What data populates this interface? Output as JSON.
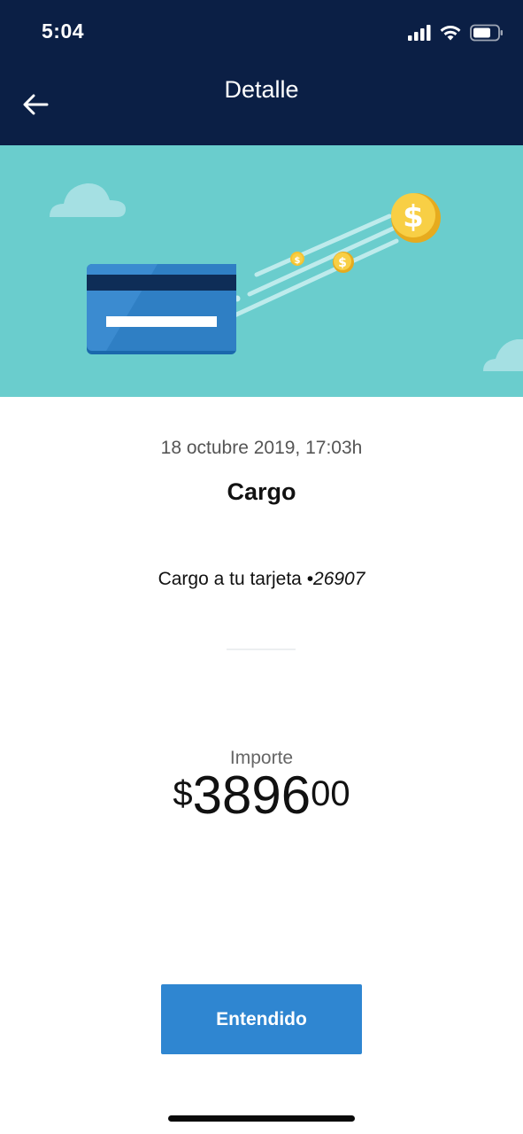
{
  "status_bar": {
    "time": "5:04",
    "icons": [
      "cellular-signal-icon",
      "wifi-icon",
      "battery-icon"
    ]
  },
  "header": {
    "title": "Detalle",
    "back_icon": "back-arrow-icon",
    "background": "#0b1f45"
  },
  "banner": {
    "illustration": "credit-card-with-flying-coins",
    "background": "#6acdcd"
  },
  "transaction": {
    "date": "18 octubre 2019, 17:03h",
    "type": "Cargo",
    "description_prefix": "Cargo a tu tarjeta ",
    "card_number": "•26907",
    "amount_label": "Importe",
    "currency_symbol": "$",
    "amount_integer": "3896",
    "amount_decimal": "00"
  },
  "actions": {
    "confirm_label": "Entendido",
    "confirm_color": "#2f86d1"
  }
}
